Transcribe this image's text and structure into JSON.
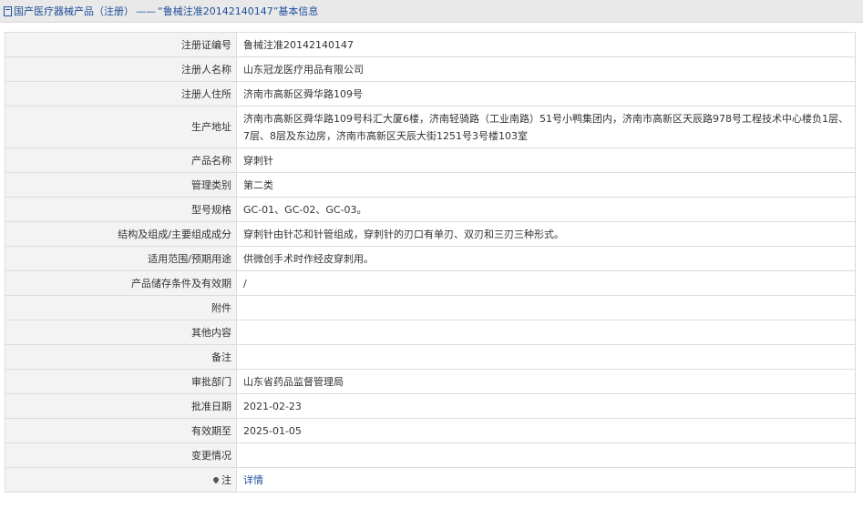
{
  "breadcrumb": {
    "category": "国产医疗器械产品（注册）",
    "separator": "——",
    "current_quote_open": "“",
    "current_name": "鲁械注准20142140147",
    "current_quote_close": "”",
    "current_suffix": "基本信息"
  },
  "rows": [
    {
      "label": "注册证编号",
      "value": "鲁械注准20142140147"
    },
    {
      "label": "注册人名称",
      "value": "山东冠龙医疗用品有限公司"
    },
    {
      "label": "注册人住所",
      "value": "济南市高新区舜华路109号"
    },
    {
      "label": "生产地址",
      "value": "济南市高新区舜华路109号科汇大厦6楼，济南轻骑路（工业南路）51号小鸭集团内，济南市高新区天辰路978号工程技术中心楼负1层、7层、8层及东边房，济南市高新区天辰大街1251号3号楼103室"
    },
    {
      "label": "产品名称",
      "value": "穿刺针"
    },
    {
      "label": "管理类别",
      "value": "第二类"
    },
    {
      "label": "型号规格",
      "value": "GC-01、GC-02、GC-03。"
    },
    {
      "label": "结构及组成/主要组成成分",
      "value": "穿刺针由针芯和针管组成，穿刺针的刃口有单刃、双刃和三刃三种形式。"
    },
    {
      "label": "适用范围/预期用途",
      "value": "供微创手术时作经皮穿刺用。"
    },
    {
      "label": "产品储存条件及有效期",
      "value": "/"
    },
    {
      "label": "附件",
      "value": ""
    },
    {
      "label": "其他内容",
      "value": ""
    },
    {
      "label": "备注",
      "value": ""
    },
    {
      "label": "审批部门",
      "value": "山东省药品监督管理局"
    },
    {
      "label": "批准日期",
      "value": "2021-02-23"
    },
    {
      "label": "有效期至",
      "value": "2025-01-05"
    },
    {
      "label": "变更情况",
      "value": ""
    }
  ],
  "note_row": {
    "label": "注",
    "link_text": "详情",
    "icon": "pin-icon"
  }
}
